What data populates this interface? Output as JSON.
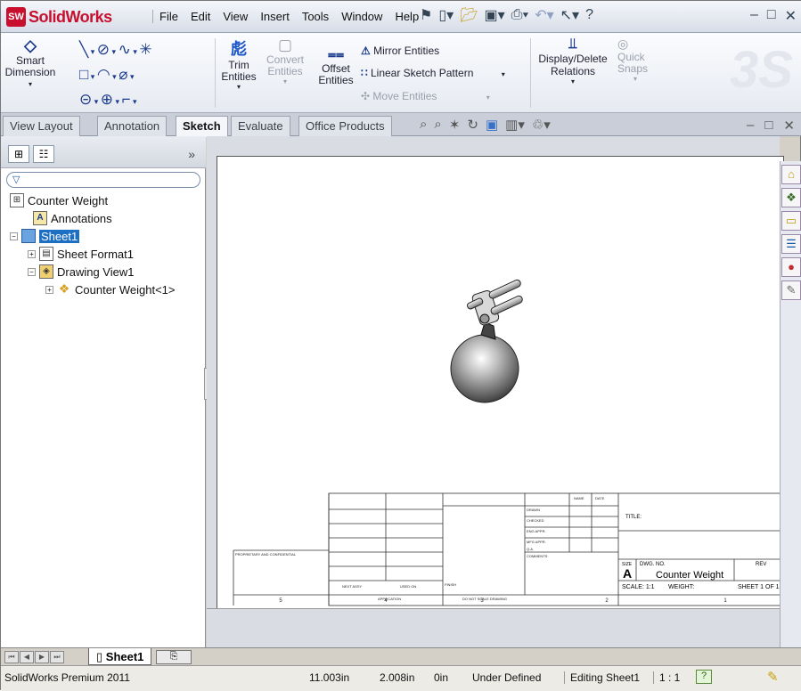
{
  "app": {
    "logo_text": "SolidWorks",
    "logo_badge": "SW"
  },
  "menu": [
    "File",
    "Edit",
    "View",
    "Insert",
    "Tools",
    "Window",
    "Help"
  ],
  "help_symbol": "?",
  "ribbon": {
    "smart_dimension": "Smart Dimension",
    "trim": "Trim Entities",
    "convert": "Convert Entities",
    "offset": "Offset Entities",
    "mirror": "Mirror Entities",
    "linear_pattern": "Linear Sketch Pattern",
    "move": "Move Entities",
    "display_delete": "Display/Delete Relations",
    "quick_snaps": "Quick Snaps"
  },
  "tabs": [
    "View Layout",
    "Annotation",
    "Sketch",
    "Evaluate",
    "Office Products"
  ],
  "active_tab": "Sketch",
  "tree": {
    "root": "Counter Weight",
    "annotations": "Annotations",
    "sheet": "Sheet1",
    "sheet_format": "Sheet Format1",
    "drawing_view": "Drawing View1",
    "part": "Counter Weight<1>"
  },
  "titleblock": {
    "part_name": "Counter Weight",
    "size": "A",
    "size_label": "SIZE",
    "dwg_no_label": "DWG. NO.",
    "rev_label": "REV",
    "title_label": "TITLE:",
    "scale": "SCALE: 1:1",
    "weight": "WEIGHT:",
    "sheet": "SHEET 1 OF 1",
    "drawn": "DRAWN",
    "checked": "CHECKED",
    "eng_appr": "ENG APPR.",
    "mfg_appr": "MFG APPR.",
    "qa": "Q.A.",
    "comments": "COMMENTS:",
    "name_hdr": "NAME",
    "date_hdr": "DATE",
    "next_assy": "NEXT ASSY",
    "used_on": "USED ON",
    "application": "APPLICATION",
    "finish": "FINISH",
    "do_not_scale": "DO NOT SCALE DRAWING",
    "proprietary": "PROPRIETARY AND CONFIDENTIAL",
    "zones": [
      "5",
      "4",
      "3",
      "2",
      "1"
    ]
  },
  "sheet_tab": "Sheet1",
  "status": {
    "product": "SolidWorks Premium 2011",
    "x": "11.003in",
    "y": "2.008in",
    "z": "0in",
    "state": "Under Defined",
    "editing": "Editing Sheet1",
    "scale": "1 : 1"
  },
  "colors": {
    "brand": "#c8102e",
    "selection": "#1d6fc4"
  }
}
